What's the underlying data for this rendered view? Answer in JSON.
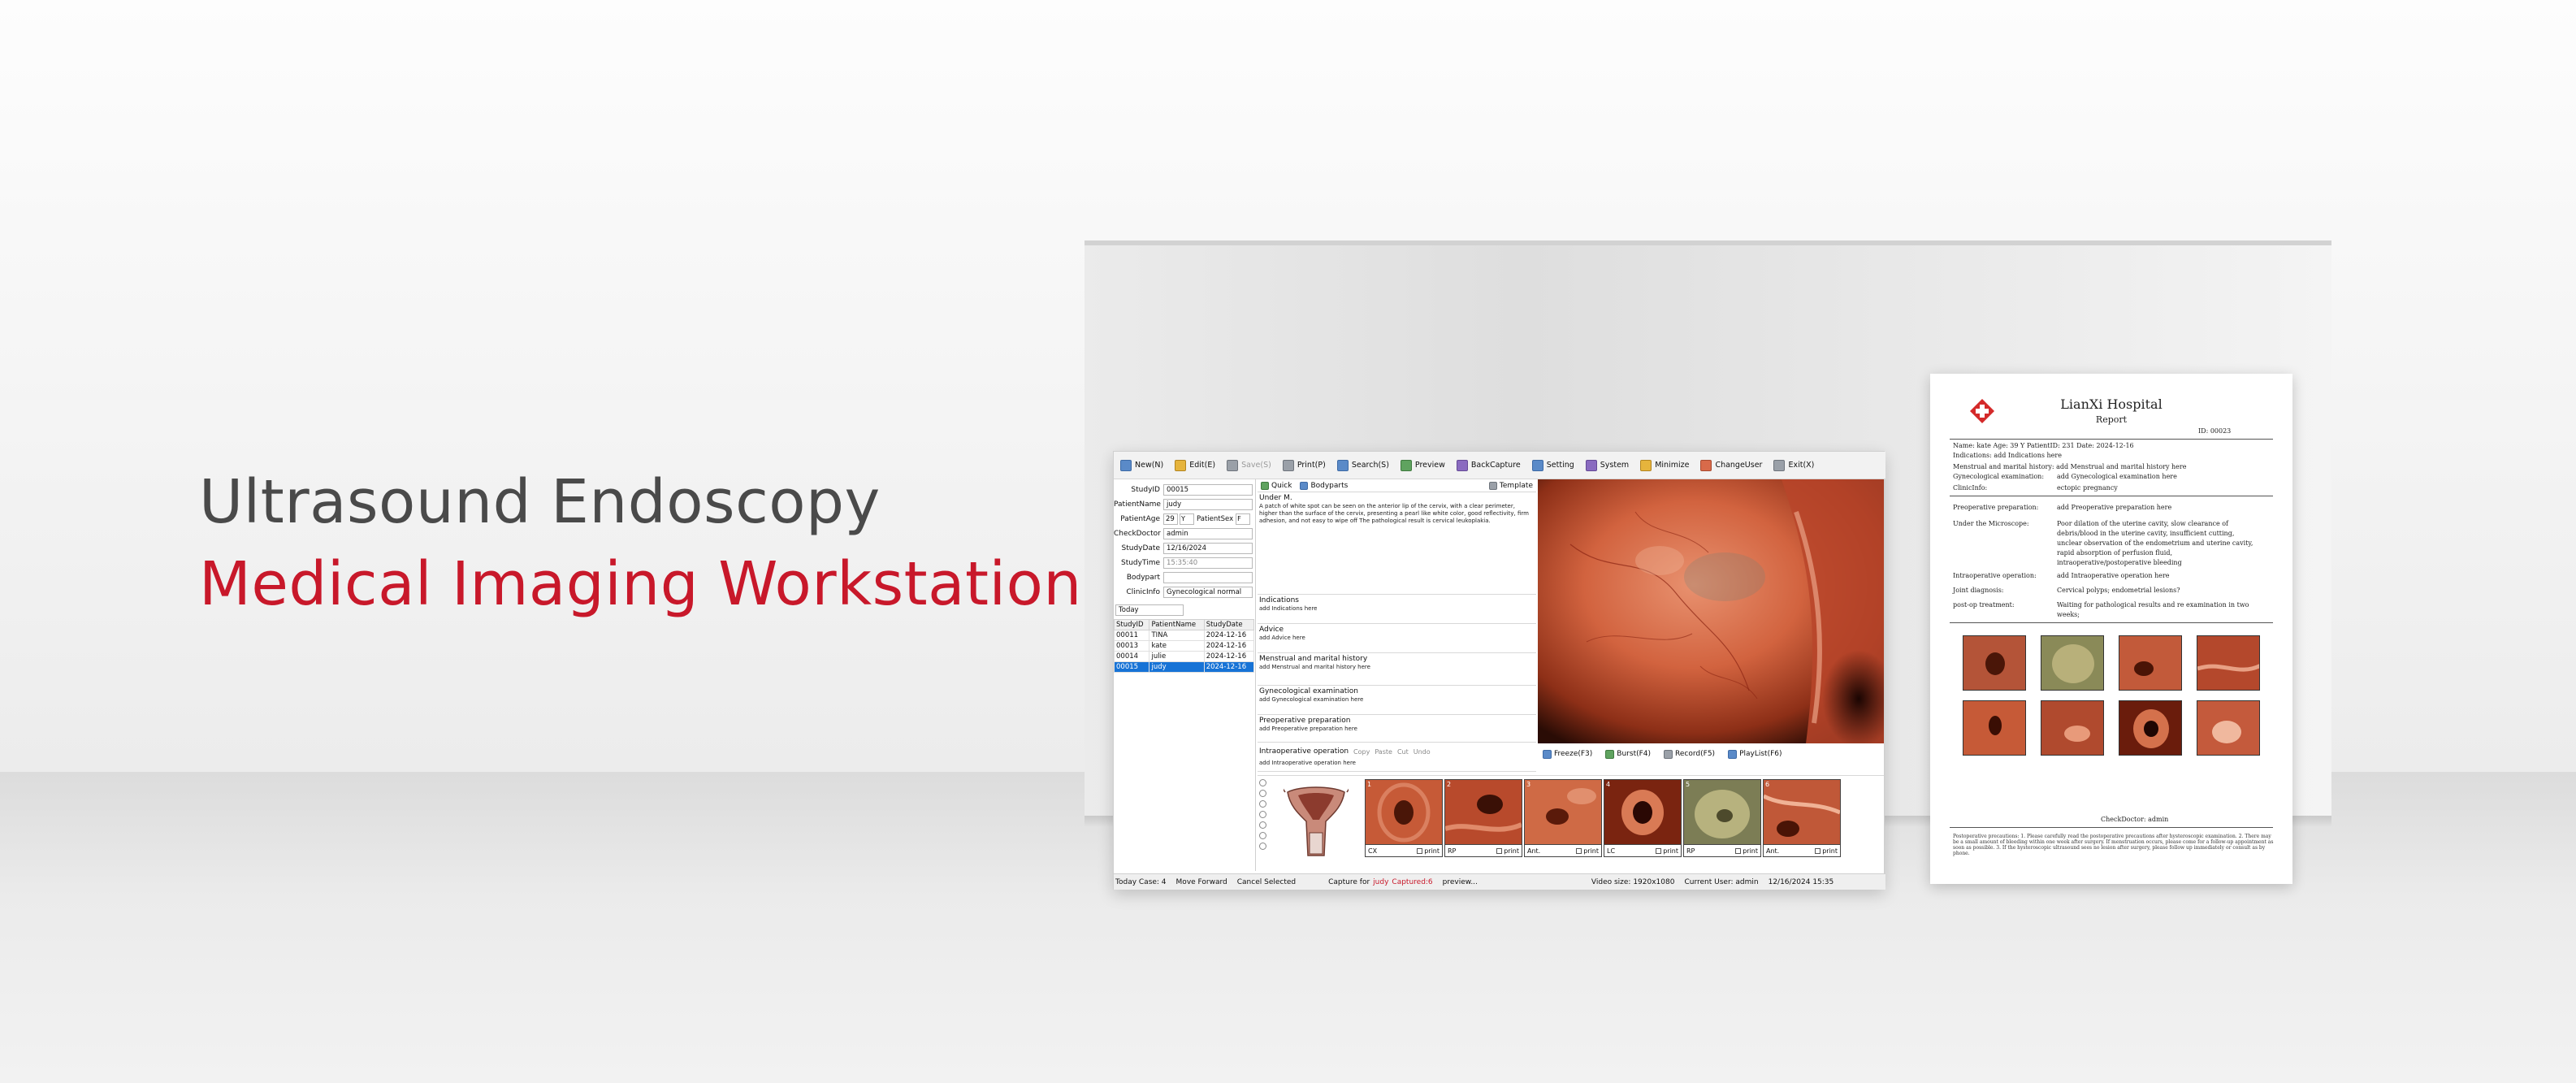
{
  "hero": {
    "line1": "Ultrasound Endoscopy",
    "line2": "Medical Imaging Workstation"
  },
  "colors": {
    "brand_red": "#c8182a",
    "selection_blue": "#1773d6"
  },
  "toolbar": [
    {
      "icon": "new-icon",
      "label": "New(N)",
      "enabled": true
    },
    {
      "icon": "edit-icon",
      "label": "Edit(E)",
      "enabled": true
    },
    {
      "icon": "save-icon",
      "label": "Save(S)",
      "enabled": false
    },
    {
      "icon": "print-icon",
      "label": "Print(P)",
      "enabled": true
    },
    {
      "icon": "search-icon",
      "label": "Search(S)",
      "enabled": true
    },
    {
      "icon": "preview-icon",
      "label": "Preview",
      "enabled": true
    },
    {
      "icon": "backcapture-icon",
      "label": "BackCapture",
      "enabled": true
    },
    {
      "icon": "setting-icon",
      "label": "Setting",
      "enabled": true
    },
    {
      "icon": "system-icon",
      "label": "System",
      "enabled": true
    },
    {
      "icon": "minimize-icon",
      "label": "Minimize",
      "enabled": true
    },
    {
      "icon": "changeuser-icon",
      "label": "ChangeUser",
      "enabled": true
    },
    {
      "icon": "exit-icon",
      "label": "Exit(X)",
      "enabled": true
    }
  ],
  "form": {
    "study_id_label": "StudyID",
    "study_id": "00015",
    "patient_name_label": "PatientName",
    "patient_name": "judy",
    "patient_age_label": "PatientAge",
    "patient_age": "29",
    "age_unit": "Y",
    "patient_sex_label": "PatientSex",
    "patient_sex": "F",
    "check_doctor_label": "CheckDoctor",
    "check_doctor": "admin",
    "study_date_label": "StudyDate",
    "study_date": "12/16/2024",
    "study_time_label": "StudyTime",
    "study_time": "15:35:40",
    "bodypart_label": "Bodypart",
    "bodypart": "",
    "clinic_info_label": "ClinicInfo",
    "clinic_info": "Gynecological normal"
  },
  "filter": {
    "value": "Today"
  },
  "patients": {
    "headers": [
      "StudyID",
      "PatientName",
      "StudyDate"
    ],
    "rows": [
      {
        "id": "00011",
        "name": "TINA",
        "date": "2024-12-16",
        "selected": false
      },
      {
        "id": "00013",
        "name": "kate",
        "date": "2024-12-16",
        "selected": false
      },
      {
        "id": "00014",
        "name": "julie",
        "date": "2024-12-16",
        "selected": false
      },
      {
        "id": "00015",
        "name": "judy",
        "date": "2024-12-16",
        "selected": true
      }
    ]
  },
  "mid": {
    "tab_quick": "Quick",
    "tab_bodyparts": "Bodyparts",
    "template": "Template",
    "under_label": "Under M.",
    "under_text": "A patch of white spot can be seen on the anterior lip of the cervix, with a clear perimeter, higher than the surface of the cervix, presenting a pearl like white color, good reflectivity, firm adhesion, and not easy to wipe off The pathological result is cervical leukoplakia.",
    "sections": [
      {
        "title": "Indications",
        "text": "add Indications here"
      },
      {
        "title": "Advice",
        "text": "add Advice here"
      },
      {
        "title": "Menstrual and marital history",
        "text": "add Menstrual and marital history here"
      },
      {
        "title": "Gynecological examination",
        "text": "add Gynecological examination here"
      },
      {
        "title": "Preoperative preparation",
        "text": "add Preoperative preparation here"
      },
      {
        "title": "Intraoperative operation",
        "text": "add Intraoperative operation here"
      }
    ],
    "edit_copy": "Copy",
    "edit_paste": "Paste",
    "edit_cut": "Cut",
    "edit_undo": "Undo"
  },
  "capture": [
    {
      "icon": "freeze-icon",
      "label": "Freeze(F3)"
    },
    {
      "icon": "burst-icon",
      "label": "Burst(F4)"
    },
    {
      "icon": "record-icon",
      "label": "Record(F5)"
    },
    {
      "icon": "playlist-icon",
      "label": "PlayList(F6)"
    }
  ],
  "thumbnails": [
    {
      "num": "1",
      "label": "CX",
      "print": "print"
    },
    {
      "num": "2",
      "label": "RP",
      "print": "print"
    },
    {
      "num": "3",
      "label": "Ant.",
      "print": "print"
    },
    {
      "num": "4",
      "label": "LC",
      "print": "print"
    },
    {
      "num": "5",
      "label": "RP",
      "print": "print"
    },
    {
      "num": "6",
      "label": "Ant.",
      "print": "print"
    }
  ],
  "status": {
    "today_case": "Today Case: 4",
    "move_forward": "Move Forward",
    "cancel_selected": "Cancel Selected",
    "capture_for": "Capture for",
    "patient": "judy",
    "captured": "Captured:6",
    "preview": "preview...",
    "video_size": "Video size: 1920x1080",
    "current_user": "Current User: admin",
    "datetime": "12/16/2024 15:35"
  },
  "report": {
    "hospital": "LianXi Hospital",
    "subtitle": "Report",
    "id": "ID: 00023",
    "header_line": "Name:  kate          Age:  39 Y         PatientID:  231          Date: 2024-12-16",
    "indications_line": "Indications:        add Indications here",
    "menstrual_line": "Menstrual and marital history:   add Menstrual and marital history here",
    "gyne_label": "Gynecological examination:",
    "gyne_value": "add Gynecological examination here",
    "clinic_label": "ClinicInfo:",
    "clinic_value": "ectopic pregnancy",
    "preop_label": "Preoperative preparation:",
    "preop_value": "add Preoperative preparation here",
    "micro_label": "Under the Microscope:",
    "micro_value": "Poor dilation of the uterine cavity, slow clearance of debris/blood in the uterine cavity, insufficient cutting, unclear observation of the endometrium and uterine cavity, rapid absorption of perfusion fluid, intraoperative/postoperative bleeding",
    "intraop_label": "Intraoperative operation:",
    "intraop_value": "add Intraoperative operation here",
    "diag_label": "Joint diagnosis:",
    "diag_value": "Cervical polyps; endometrial lesions?",
    "postop_label": "post-op treatment:",
    "postop_value": "Waiting for pathological results and re examination in two weeks;",
    "doctor": "CheckDoctor:    admin",
    "footer": "Postoperative precautions: 1. Please carefully read the postoperative precautions after hysteroscopic examination. 2. There may be a small amount of bleeding within one week after surgery. If menstruation occurs, please come for a follow-up appointment as soon as possible. 3. If the hysteroscopic ultrasound sees no lesion after surgery, please follow up immediately or consult as by phone."
  }
}
